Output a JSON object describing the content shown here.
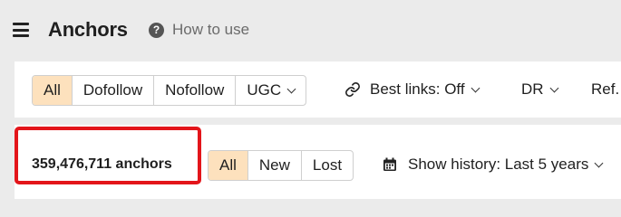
{
  "header": {
    "title": "Anchors",
    "help_label": "How to use"
  },
  "filters": {
    "link_types": [
      {
        "label": "All",
        "active": true
      },
      {
        "label": "Dofollow",
        "active": false
      },
      {
        "label": "Nofollow",
        "active": false
      },
      {
        "label": "UGC",
        "active": false
      }
    ],
    "best_links_label": "Best links: Off",
    "dr_label": "DR",
    "ref_label": "Ref."
  },
  "results": {
    "count_text": "359,476,711 anchors",
    "status_tabs": [
      {
        "label": "All",
        "active": true
      },
      {
        "label": "New",
        "active": false
      },
      {
        "label": "Lost",
        "active": false
      }
    ],
    "history_label": "Show history: Last 5 years"
  },
  "colors": {
    "active_segment": "#fde1bd",
    "highlight_border": "#e3151a",
    "page_background": "#ebebeb"
  },
  "icons": {
    "menu": "hamburger-icon",
    "help": "question-circle-icon",
    "best_links": "link-icon",
    "history": "calendar-icon"
  }
}
